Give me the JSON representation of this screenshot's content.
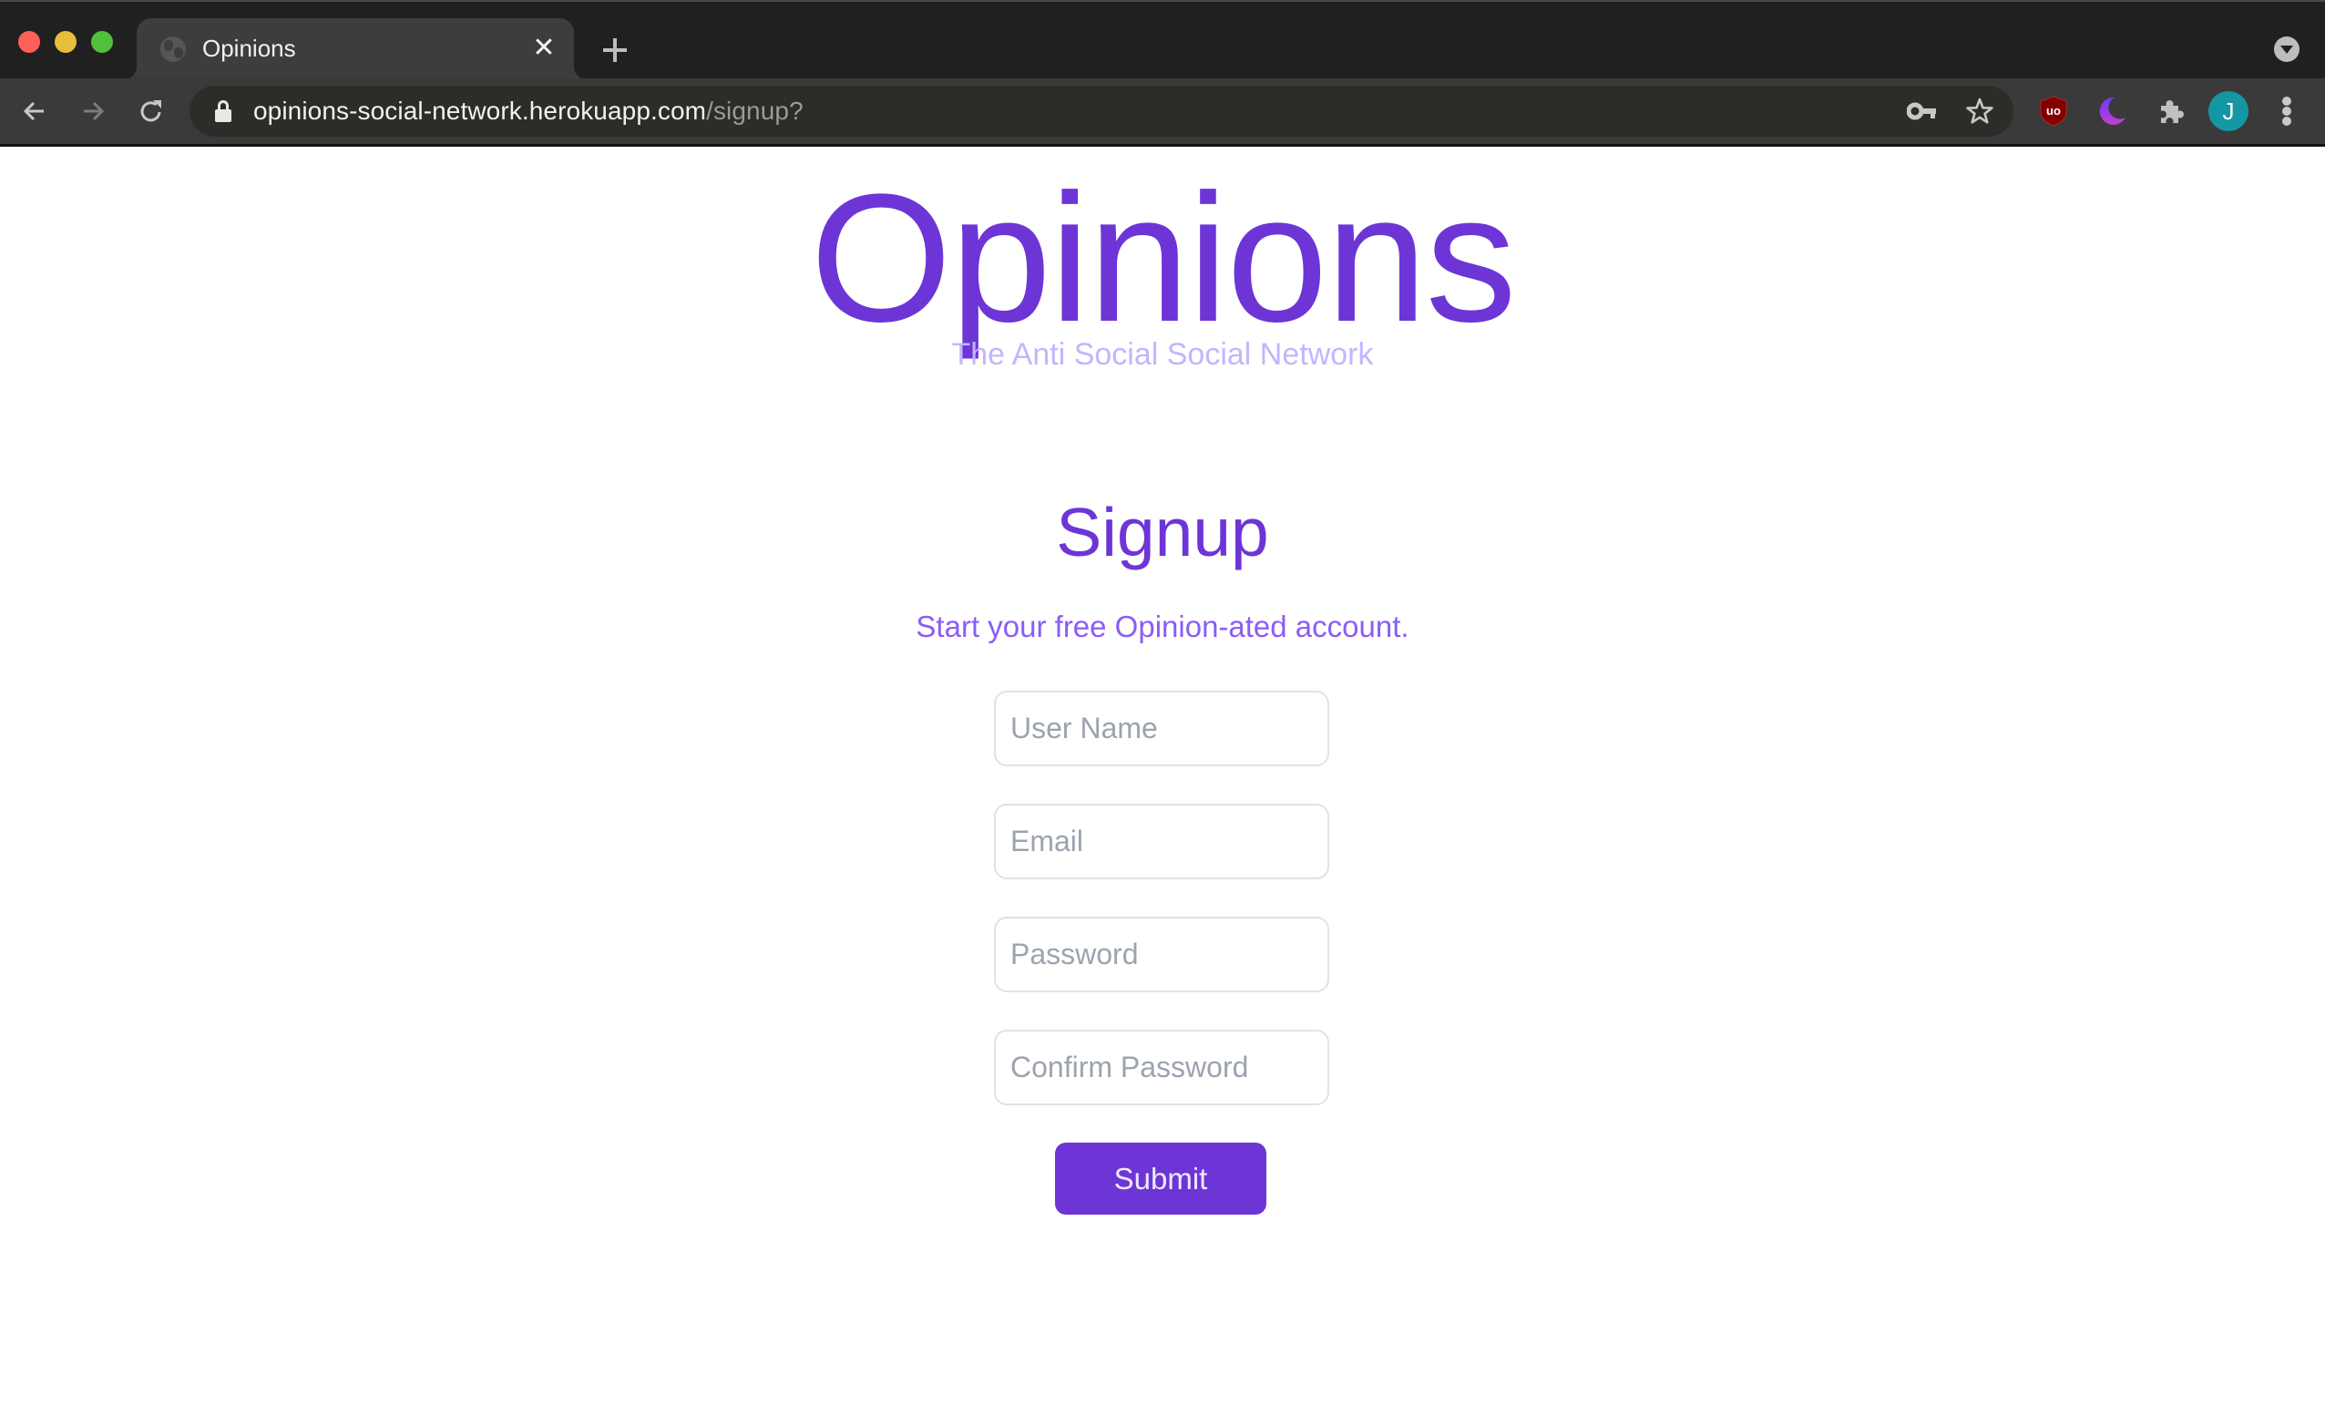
{
  "browser": {
    "tab": {
      "title": "Opinions",
      "favicon": "globe-icon",
      "close_icon": "close-icon"
    },
    "new_tab_icon": "plus-icon",
    "tab_search_icon": "chevron-down-circle-icon",
    "nav": {
      "back_icon": "arrow-left-icon",
      "forward_icon": "arrow-right-icon",
      "reload_icon": "reload-icon"
    },
    "address_bar": {
      "secure_icon": "lock-icon",
      "host": "opinions-social-network.herokuapp.com",
      "path": "/signup?"
    },
    "omnibox_icons": [
      "key-icon",
      "star-icon"
    ],
    "extensions": [
      "ublock-origin-icon",
      "dark-mode-moon-icon",
      "puzzle-piece-icon"
    ],
    "profile_initial": "J",
    "colors": {
      "profile_avatar": "#1596a3",
      "ublock": "#800000"
    }
  },
  "site": {
    "logo": "Opinions",
    "tagline": "The Anti Social Social Network",
    "colors": {
      "brand": "#6d35d6",
      "tagline": "#c4b5fd",
      "subtitle": "#8b5cf6"
    }
  },
  "signup": {
    "title": "Signup",
    "subtitle": "Start your free Opinion-ated account.",
    "fields": {
      "username": {
        "placeholder": "User Name",
        "value": ""
      },
      "email": {
        "placeholder": "Email",
        "value": ""
      },
      "password": {
        "placeholder": "Password",
        "value": ""
      },
      "confirm_password": {
        "placeholder": "Confirm Password",
        "value": ""
      }
    },
    "submit_label": "Submit"
  }
}
